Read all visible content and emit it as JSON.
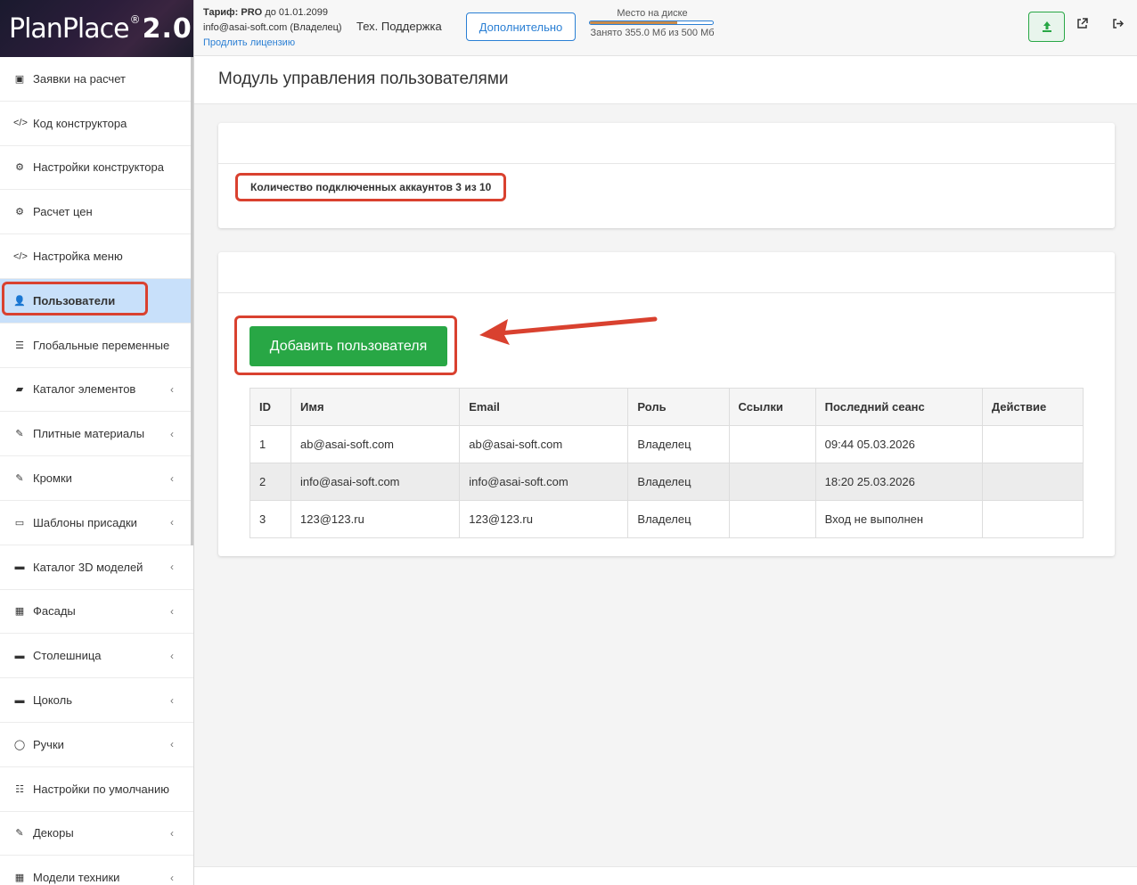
{
  "logo": {
    "main": "PlanPlace",
    "reg": "®",
    "version": "2.0"
  },
  "sidebar": {
    "items": [
      {
        "label": "Заявки на расчет",
        "icon": "calculator-icon",
        "glyph": "▣",
        "chevron": false
      },
      {
        "label": "Код конструктора",
        "icon": "code-icon",
        "glyph": "</>",
        "chevron": false
      },
      {
        "label": "Настройки конструктора",
        "icon": "gears-icon",
        "glyph": "⚙",
        "chevron": false
      },
      {
        "label": "Расчет цен",
        "icon": "gears-icon",
        "glyph": "⚙",
        "chevron": false
      },
      {
        "label": "Настройка меню",
        "icon": "code-icon",
        "glyph": "</>",
        "chevron": false
      },
      {
        "label": "Пользователи",
        "icon": "user-icon",
        "glyph": "👤",
        "chevron": false,
        "active": true
      },
      {
        "label": "Глобальные переменные",
        "icon": "list-icon",
        "glyph": "☰",
        "chevron": false
      },
      {
        "label": "Каталог элементов",
        "icon": "book-icon",
        "glyph": "▰",
        "chevron": true
      },
      {
        "label": "Плитные материалы",
        "icon": "brush-icon",
        "glyph": "✎",
        "chevron": true
      },
      {
        "label": "Кромки",
        "icon": "brush-icon",
        "glyph": "✎",
        "chevron": true
      },
      {
        "label": "Шаблоны присадки",
        "icon": "window-icon",
        "glyph": "▭",
        "chevron": true
      },
      {
        "label": "Каталог 3D моделей",
        "icon": "minus-icon",
        "glyph": "▬",
        "chevron": true
      },
      {
        "label": "Фасады",
        "icon": "building-icon",
        "glyph": "▦",
        "chevron": true
      },
      {
        "label": "Столешница",
        "icon": "minus-square-icon",
        "glyph": "▬",
        "chevron": true
      },
      {
        "label": "Цоколь",
        "icon": "minus-icon",
        "glyph": "▬",
        "chevron": true
      },
      {
        "label": "Ручки",
        "icon": "handle-icon",
        "glyph": "◯",
        "chevron": true
      },
      {
        "label": "Настройки по умолчанию",
        "icon": "settings-list-icon",
        "glyph": "☷",
        "chevron": false
      },
      {
        "label": "Декоры",
        "icon": "brush-icon",
        "glyph": "✎",
        "chevron": true
      },
      {
        "label": "Модели техники",
        "icon": "calculator-icon",
        "glyph": "▦",
        "chevron": true
      }
    ]
  },
  "topbar": {
    "tariff_label": "Тариф:",
    "tariff_value": "PRO",
    "tariff_until": "до 01.01.2099",
    "account": "info@asai-soft.com (Владелец)",
    "renew_link": "Продлить лицензию",
    "support": "Тех. Поддержка",
    "more_button": "Дополнительно",
    "disk_title": "Место на диске",
    "disk_used": "Занято 355.0 Мб из 500 Мб",
    "disk_fraction": 0.71
  },
  "page": {
    "title": "Модуль управления пользователями",
    "accounts_count": "Количество подключенных аккаунтов 3 из 10",
    "add_button": "Добавить пользователя"
  },
  "table": {
    "headers": [
      "ID",
      "Имя",
      "Email",
      "Роль",
      "Ссылки",
      "Последний сеанс",
      "Действие"
    ],
    "rows": [
      [
        "1",
        "ab@asai-soft.com",
        "ab@asai-soft.com",
        "Владелец",
        "",
        "09:44 05.03.2026",
        ""
      ],
      [
        "2",
        "info@asai-soft.com",
        "info@asai-soft.com",
        "Владелец",
        "",
        "18:20 25.03.2026",
        ""
      ],
      [
        "3",
        "123@123.ru",
        "123@123.ru",
        "Владелец",
        "",
        "Вход не выполнен",
        ""
      ]
    ]
  },
  "colors": {
    "accent": "#2a7fd4",
    "success": "#28a745",
    "highlight": "#d9412f",
    "active_bg": "#c8e0fa"
  }
}
